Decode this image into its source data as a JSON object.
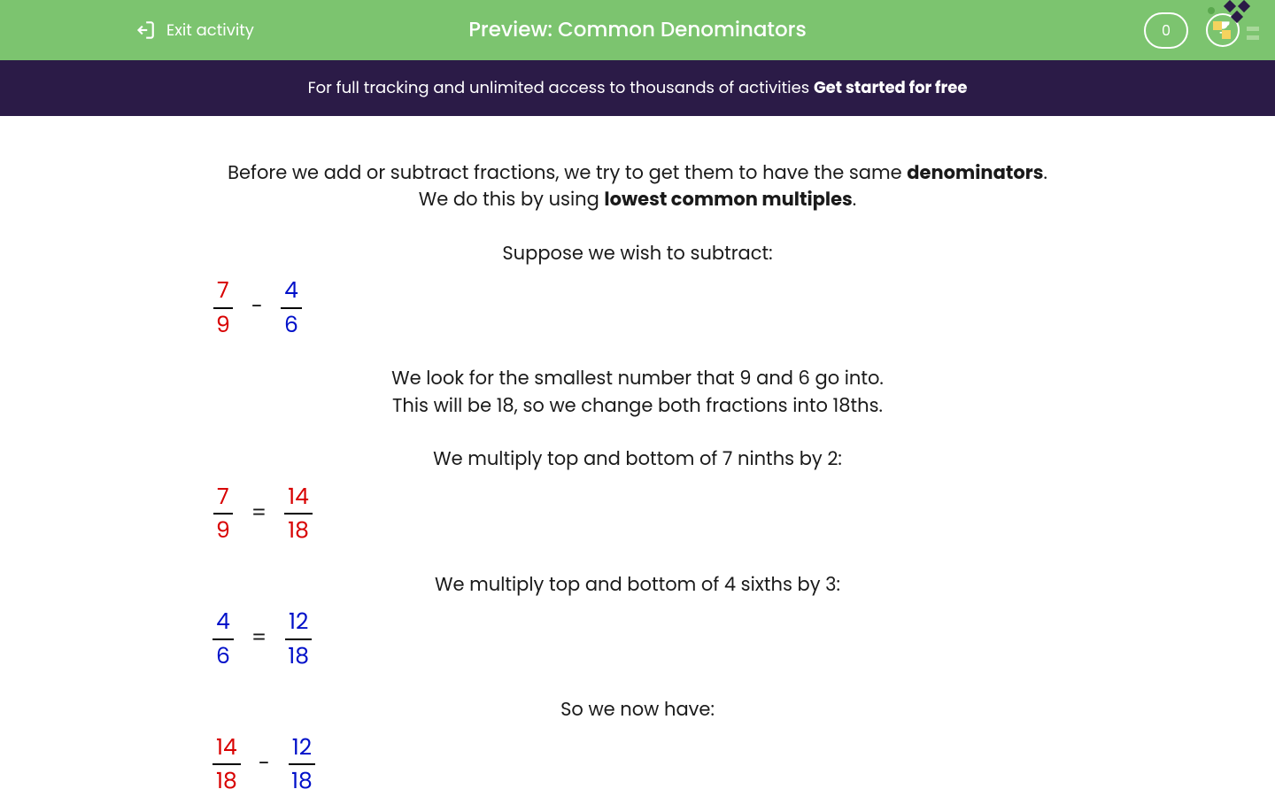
{
  "header": {
    "exit_label": "Exit activity",
    "title": "Preview: Common Denominators",
    "score": "0"
  },
  "banner": {
    "text": "For full tracking and unlimited access to thousands of activities ",
    "cta": "Get started for free"
  },
  "content": {
    "intro_before": "Before we add or subtract fractions, we try to get them to have the same ",
    "intro_bold1": "denominators",
    "intro_after": ".",
    "line2_before": "We do this by using ",
    "line2_bold": "lowest common multiples",
    "line2_after": ".",
    "subtract_heading": "Suppose we wish to subtract:",
    "row1": {
      "f1n": "7",
      "f1d": "9",
      "op": "-",
      "f2n": "4",
      "f2d": "6"
    },
    "explain1": "We look for the smallest number that 9 and 6 go into.",
    "explain2": "This will be 18, so we change both fractions into 18ths.",
    "mult1": "We multiply top and bottom of 7 ninths by 2:",
    "row2": {
      "f1n": "7",
      "f1d": "9",
      "op": "=",
      "f2n": "14",
      "f2d": "18"
    },
    "mult2": "We multiply top and bottom of 4 sixths by 3:",
    "row3": {
      "f1n": "4",
      "f1d": "6",
      "op": "=",
      "f2n": "12",
      "f2d": "18"
    },
    "so_now": "So we now have:",
    "row4": {
      "f1n": "14",
      "f1d": "18",
      "op": "-",
      "f2n": "12",
      "f2d": "18"
    }
  }
}
